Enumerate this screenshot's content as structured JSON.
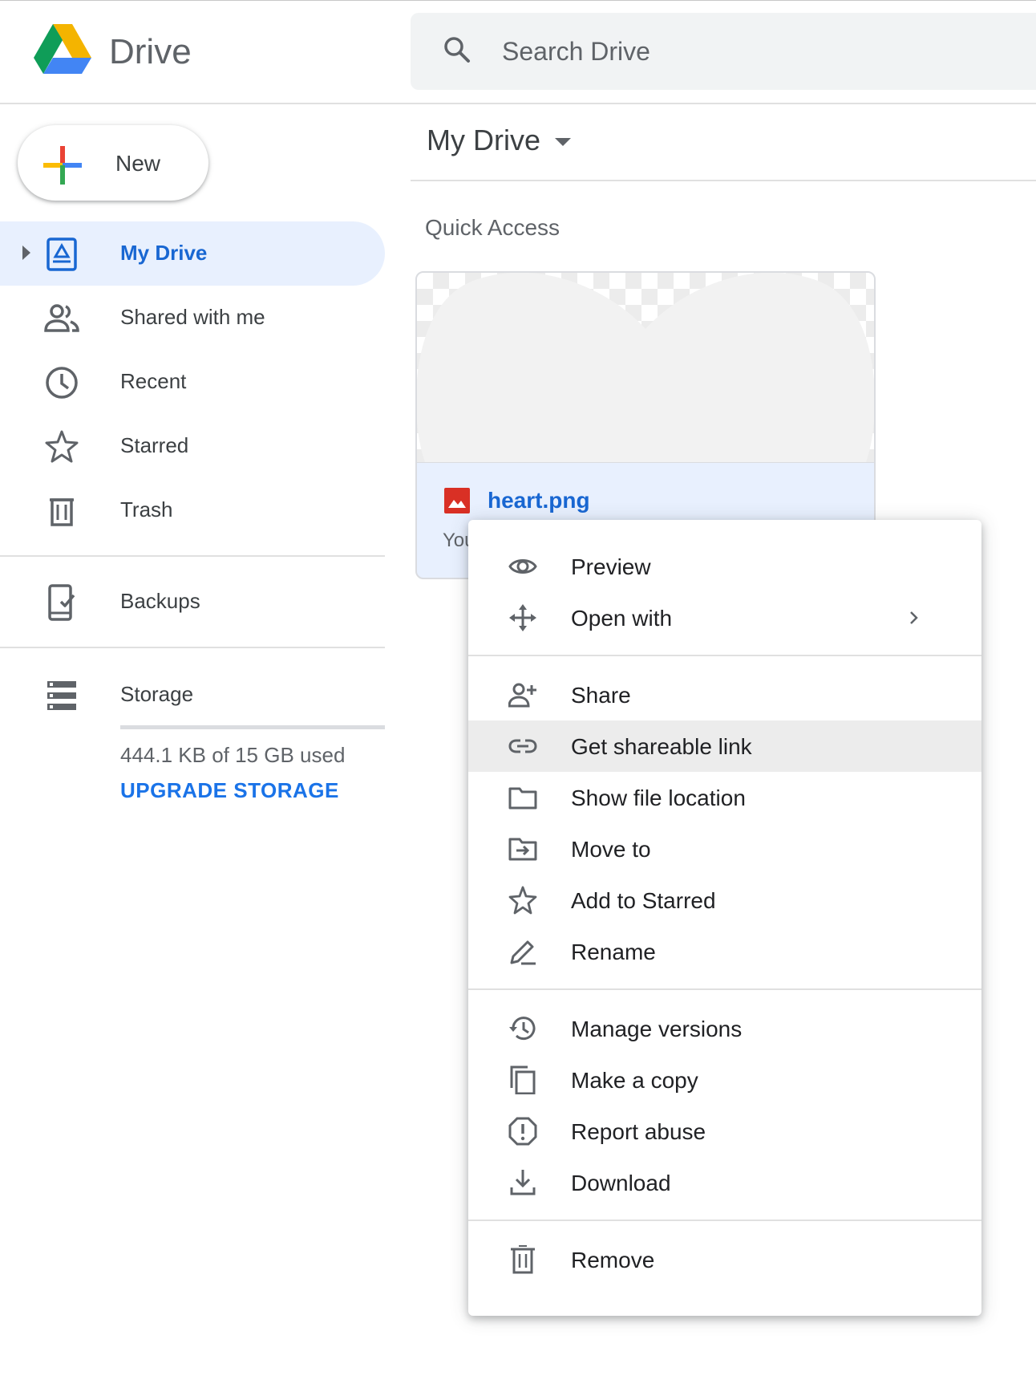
{
  "app": {
    "name": "Drive",
    "colors": {
      "accent": "#1a73e8",
      "active_bg": "#e8f0fe",
      "logo_green": "#0f9d58",
      "logo_yellow": "#f4b400",
      "logo_blue": "#4285f4",
      "file_red": "#d93025"
    }
  },
  "search": {
    "placeholder": "Search Drive",
    "icon": "search-icon"
  },
  "sidebar": {
    "new_button": {
      "label": "New",
      "icon": "plus-icon"
    },
    "items": [
      {
        "label": "My Drive",
        "icon": "my-drive-icon",
        "active": true,
        "expandable": true
      },
      {
        "label": "Shared with me",
        "icon": "people-icon"
      },
      {
        "label": "Recent",
        "icon": "clock-icon"
      },
      {
        "label": "Starred",
        "icon": "star-icon"
      },
      {
        "label": "Trash",
        "icon": "trash-icon"
      },
      {
        "label": "Backups",
        "icon": "backup-icon"
      },
      {
        "label": "Storage",
        "icon": "storage-icon"
      }
    ],
    "storage": {
      "used_text": "444.1 KB of 15 GB used",
      "used_fraction": 3e-05,
      "upgrade_label": "UPGRADE STORAGE"
    }
  },
  "main": {
    "title": "My Drive",
    "section_title": "Quick Access",
    "file": {
      "name": "heart.png",
      "meta": "You",
      "icon": "image-file-icon"
    }
  },
  "context_menu": {
    "items": [
      {
        "label": "Preview",
        "icon": "eye-icon"
      },
      {
        "label": "Open with",
        "icon": "move-arrows-icon",
        "submenu": true
      },
      {
        "label": "Share",
        "icon": "person-add-icon"
      },
      {
        "label": "Get shareable link",
        "icon": "link-icon",
        "highlighted": true
      },
      {
        "label": "Show file location",
        "icon": "folder-icon"
      },
      {
        "label": "Move to",
        "icon": "folder-move-icon"
      },
      {
        "label": "Add to Starred",
        "icon": "star-icon"
      },
      {
        "label": "Rename",
        "icon": "pencil-icon"
      },
      {
        "label": "Manage versions",
        "icon": "history-icon"
      },
      {
        "label": "Make a copy",
        "icon": "copy-icon"
      },
      {
        "label": "Report abuse",
        "icon": "report-icon"
      },
      {
        "label": "Download",
        "icon": "download-icon"
      },
      {
        "label": "Remove",
        "icon": "trash-icon"
      }
    ]
  }
}
